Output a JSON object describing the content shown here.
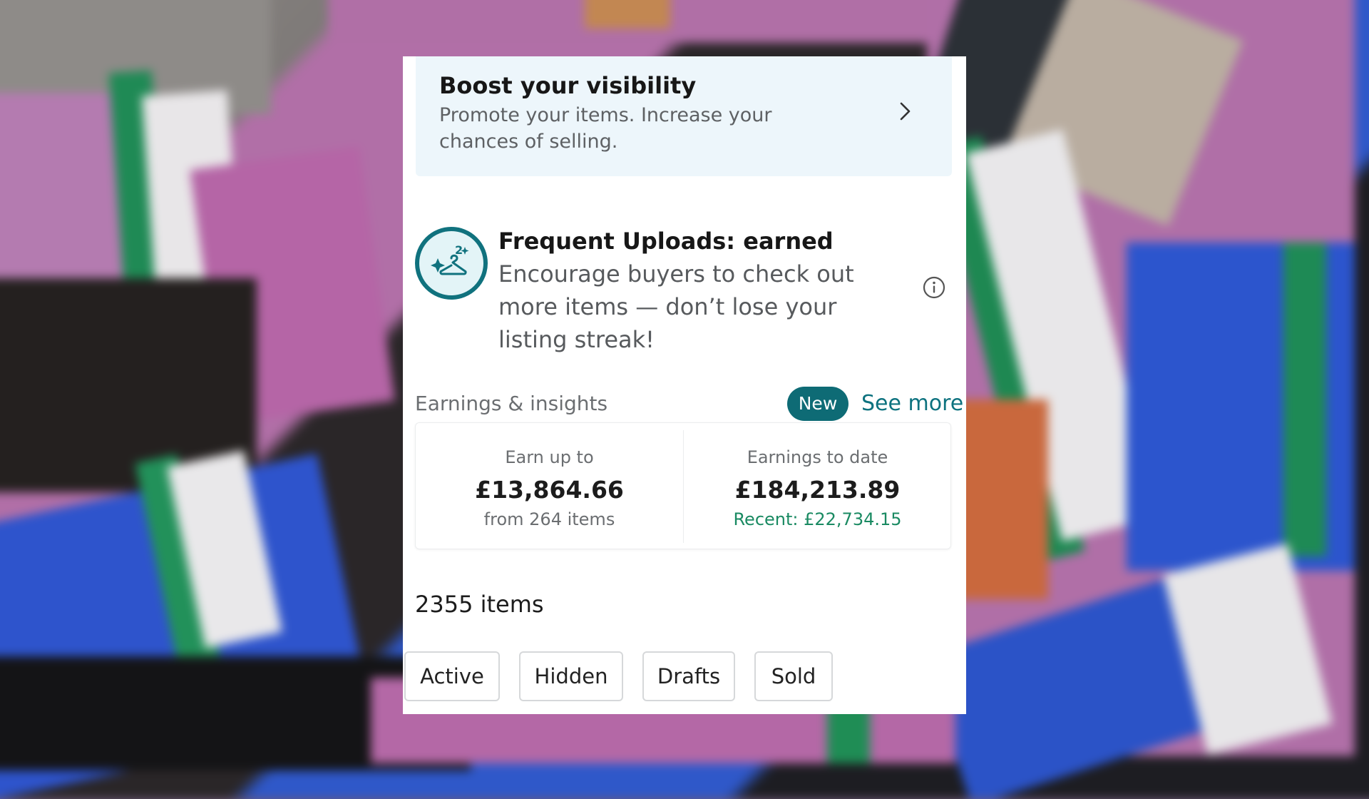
{
  "boost": {
    "title": "Boost your visibility",
    "subtitle": "Promote your items. Increase your chances of selling.",
    "icon": "chevron-right-icon"
  },
  "frequent_uploads": {
    "icon": "hanger-sparkle-badge-icon",
    "title": "Frequent Uploads: earned",
    "text": "Encourage buyers to check out more items — don’t lose your listing streak!",
    "info_icon": "info-icon"
  },
  "earnings": {
    "label": "Earnings & insights",
    "new_badge": "New",
    "see_more": "See more",
    "earn_up_to": {
      "label": "Earn up to",
      "value": "£13,864.66",
      "sub": "from 264 items"
    },
    "earnings_to_date": {
      "label": "Earnings to date",
      "value": "£184,213.89",
      "sub": "Recent: £22,734.15"
    }
  },
  "items": {
    "count_label": "2355 items",
    "filters": [
      "Active",
      "Hidden",
      "Drafts",
      "Sold"
    ]
  },
  "colors": {
    "accent": "#0e6b75",
    "link": "#0d727f",
    "positive": "#1a8a62",
    "boost_bg": "#edf6fb"
  }
}
